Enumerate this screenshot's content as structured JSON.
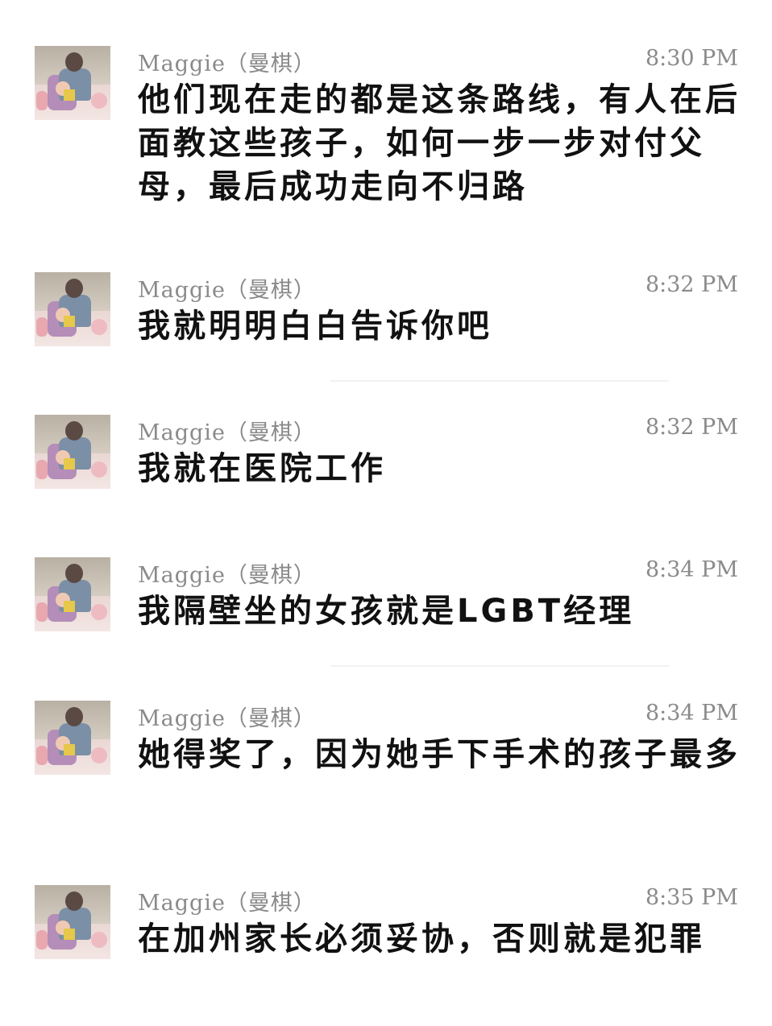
{
  "messages": [
    {
      "sender": "Maggie（曼棋）",
      "time": "8:30 PM",
      "text": "他们现在走的都是这条路线，有人在后面教这些孩子，如何一步一步对付父母，最后成功走向不归路"
    },
    {
      "sender": "Maggie（曼棋）",
      "time": "8:32 PM",
      "text": "我就明明白白告诉你吧"
    },
    {
      "sender": "Maggie（曼棋）",
      "time": "8:32 PM",
      "text": "我就在医院工作"
    },
    {
      "sender": "Maggie（曼棋）",
      "time": "8:34 PM",
      "text": "我隔壁坐的女孩就是LGBT经理"
    },
    {
      "sender": "Maggie（曼棋）",
      "time": "8:34 PM",
      "text": "她得奖了，因为她手下手术的孩子最多"
    },
    {
      "sender": "Maggie（曼棋）",
      "time": "8:35 PM",
      "text": "在加州家长必须妥协，否则就是犯罪"
    }
  ]
}
